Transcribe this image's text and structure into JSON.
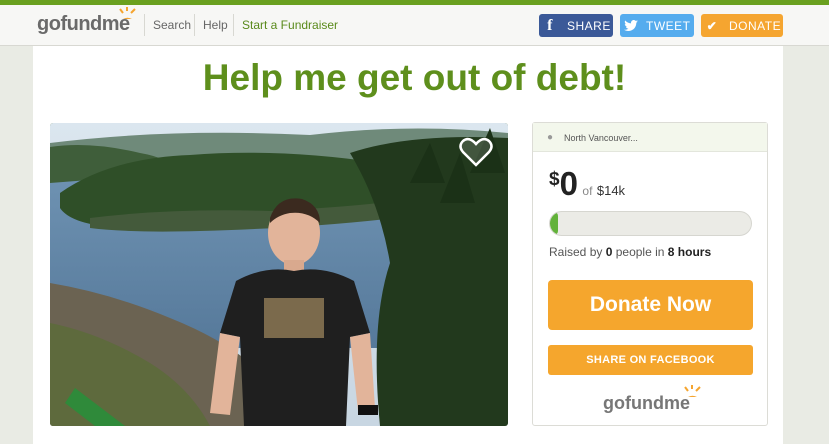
{
  "header": {
    "logo": {
      "go": "go",
      "fund": "fund",
      "me": "me"
    },
    "nav": {
      "search": "Search",
      "help": "Help",
      "start": "Start a Fundraiser"
    },
    "share": {
      "facebook": "SHARE",
      "twitter": "TWEET",
      "donate": "DONATE"
    }
  },
  "campaign": {
    "title": "Help me get out of debt!",
    "location": "North Vancouver...",
    "currency": "$",
    "raised_amount": "0",
    "of_label": "of",
    "goal": "$14k",
    "progress_fraction": 0.04,
    "raised_prefix": "Raised by ",
    "people_count": "0",
    "people_mid": " people in ",
    "duration": "8 hours",
    "donate_now": "Donate Now",
    "share_facebook": "SHARE ON FACEBOOK"
  },
  "colors": {
    "brand_green": "#5e8f1c",
    "orange": "#f5a62d",
    "facebook": "#3b5998",
    "twitter": "#55acee"
  },
  "icons": [
    "gofundme-logo",
    "facebook-icon",
    "twitter-icon",
    "checkmark-icon",
    "heart-icon",
    "location-pin-icon"
  ]
}
